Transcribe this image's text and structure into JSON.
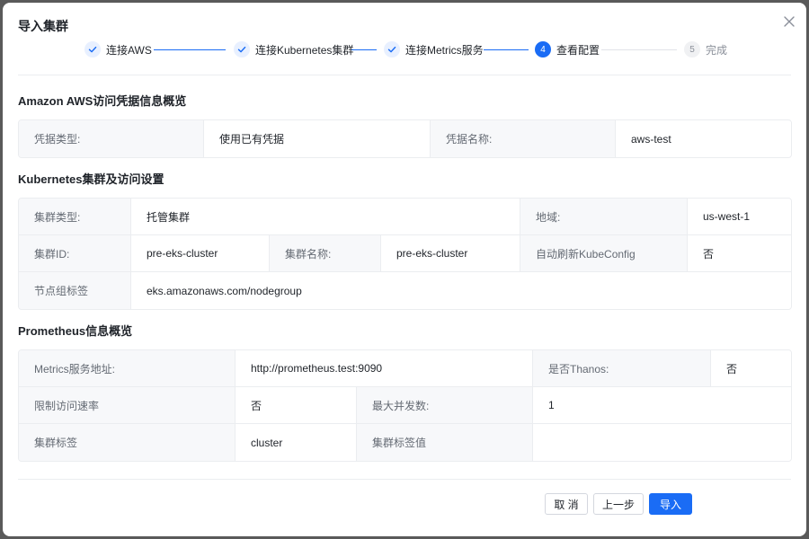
{
  "dialog": {
    "title": "导入集群"
  },
  "steps": [
    {
      "label": "连接AWS",
      "state": "done"
    },
    {
      "label": "连接Kubernetes集群",
      "state": "done"
    },
    {
      "label": "连接Metrics服务",
      "state": "done"
    },
    {
      "label": "查看配置",
      "state": "active",
      "number": "4"
    },
    {
      "label": "完成",
      "state": "todo",
      "number": "5"
    }
  ],
  "aws": {
    "title": "Amazon AWS访问凭据信息概览",
    "credential_type_label": "凭据类型:",
    "credential_type_value": "使用已有凭据",
    "credential_name_label": "凭据名称:",
    "credential_name_value": "aws-test"
  },
  "k8s": {
    "title": "Kubernetes集群及访问设置",
    "cluster_type_label": "集群类型:",
    "cluster_type_value": "托管集群",
    "region_label": "地域:",
    "region_value": "us-west-1",
    "cluster_id_label": "集群ID:",
    "cluster_id_value": "pre-eks-cluster",
    "cluster_name_label": "集群名称:",
    "cluster_name_value": "pre-eks-cluster",
    "auto_refresh_label": "自动刷新KubeConfig",
    "auto_refresh_value": "否",
    "node_group_label": "节点组标签",
    "node_group_value": "eks.amazonaws.com/nodegroup"
  },
  "prom": {
    "title": "Prometheus信息概览",
    "metrics_addr_label": "Metrics服务地址:",
    "metrics_addr_value": "http://prometheus.test:9090",
    "thanos_label": "是否Thanos:",
    "thanos_value": "否",
    "rate_limit_label": "限制访问速率",
    "rate_limit_value": "否",
    "max_concurrency_label": "最大并发数:",
    "max_concurrency_value": "1",
    "cluster_tag_label": "集群标签",
    "cluster_tag_value": "cluster",
    "cluster_tag_value_label": "集群标签值",
    "cluster_tag_value_value": ""
  },
  "footer": {
    "cancel_label": "取 消",
    "prev_label": "上一步",
    "import_label": "导入"
  },
  "colors": {
    "primary": "#1a6cf5",
    "label_bg": "#f7f8fa",
    "border": "#ebedf0"
  }
}
